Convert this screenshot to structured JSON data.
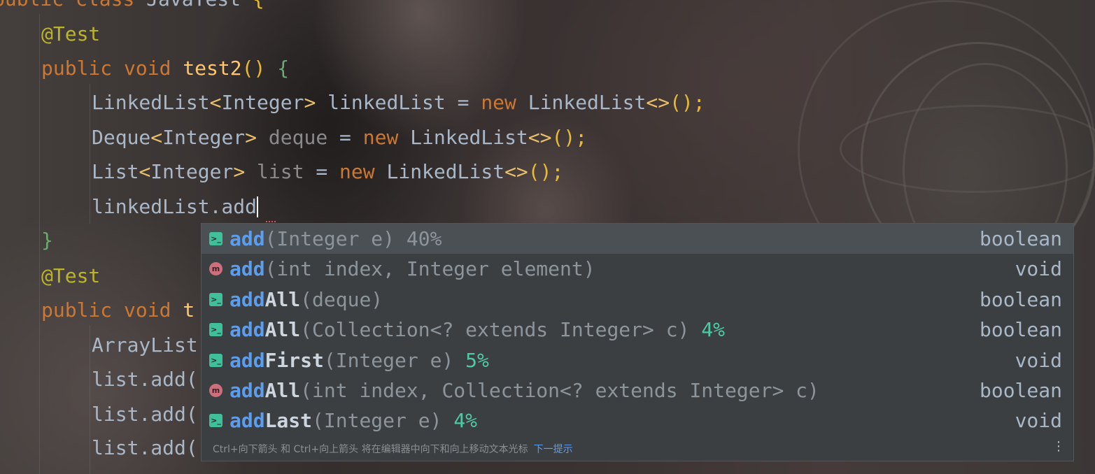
{
  "code_lines": [
    "public class JavaTest {",
    "    @Test",
    "    public void test2() {",
    "        LinkedList<Integer> linkedList = new LinkedList<>();",
    "        Deque<Integer> deque = new LinkedList<>();",
    "        List<Integer> list = new LinkedList<>();",
    "        linkedList.add",
    "    }",
    "    @Test",
    "    public void t",
    "        ArrayList",
    "        list.add(",
    "        list.add(",
    "        list.add("
  ],
  "code": {
    "l0": {
      "kw": "public class ",
      "name": "JavaTest",
      "brace": " {"
    },
    "l1": {
      "ann": "@Test"
    },
    "l2": {
      "kw1": "public ",
      "kw2": "void ",
      "fn": "test2",
      "paren": "() ",
      "brace": "{"
    },
    "l3": {
      "t1": "LinkedList",
      "g1": "<",
      "t2": "Integer",
      "g2": ">",
      "var": " linkedList = ",
      "kw": "new ",
      "t3": "LinkedList",
      "g3": "<>",
      "end": "();"
    },
    "l4": {
      "t1": "Deque",
      "g1": "<",
      "t2": "Integer",
      "g2": ">",
      "var": " deque",
      "eq": " = ",
      "kw": "new ",
      "t3": "LinkedList",
      "g3": "<>",
      "end": "();"
    },
    "l5": {
      "t1": "List",
      "g1": "<",
      "t2": "Integer",
      "g2": ">",
      "var": " list",
      "eq": " = ",
      "kw": "new ",
      "t3": "LinkedList",
      "g3": "<>",
      "end": "();"
    },
    "l6": {
      "text": "linkedList.add"
    },
    "l7": {
      "brace": "}"
    },
    "l8": {
      "ann": "@Test"
    },
    "l9": {
      "kw1": "public ",
      "kw2": "void ",
      "fn": "t"
    },
    "l10": {
      "text": "ArrayList"
    },
    "l11": {
      "text": "list.add("
    },
    "l12": {
      "text": "list.add("
    },
    "l13": {
      "text": "list.add("
    }
  },
  "completion": {
    "items": [
      {
        "icon": "extension-method-icon",
        "match": "add",
        "rest": "",
        "params": "(Integer e) 40%",
        "pct": "",
        "return_type": "boolean",
        "selected": true
      },
      {
        "icon": "method-icon",
        "match": "add",
        "rest": "",
        "params": "(int index, Integer element)",
        "pct": "",
        "return_type": "void"
      },
      {
        "icon": "extension-method-icon",
        "match": "add",
        "rest": "All",
        "params": "(deque)",
        "pct": "",
        "return_type": "boolean"
      },
      {
        "icon": "extension-method-icon",
        "match": "add",
        "rest": "All",
        "params": "(Collection<? extends Integer> c) ",
        "pct": "4%",
        "return_type": "boolean"
      },
      {
        "icon": "extension-method-icon",
        "match": "add",
        "rest": "First",
        "params": "(Integer e) ",
        "pct": "5%",
        "return_type": "void"
      },
      {
        "icon": "method-icon",
        "match": "add",
        "rest": "All",
        "params": "(int index, Collection<? extends Integer> c)",
        "pct": "",
        "return_type": "boolean"
      },
      {
        "icon": "extension-method-icon",
        "match": "add",
        "rest": "Last",
        "params": "(Integer e) ",
        "pct": "4%",
        "return_type": "void"
      }
    ],
    "icon_glyphs": {
      "extension": ">_",
      "method": "m"
    },
    "footer_hint": "Ctrl+向下箭头 和 Ctrl+向上箭头 将在编辑器中向下和向上移动文本光标",
    "footer_link": "下一提示",
    "more_glyph": "⋮"
  },
  "colors": {
    "keyword": "#cc7832",
    "annotation": "#bbb529",
    "function": "#ffc66d",
    "match_highlight": "#5c9ded",
    "percent": "#4ec9a3",
    "popup_bg": "#3c3f41",
    "selected_bg": "#4b5054"
  }
}
